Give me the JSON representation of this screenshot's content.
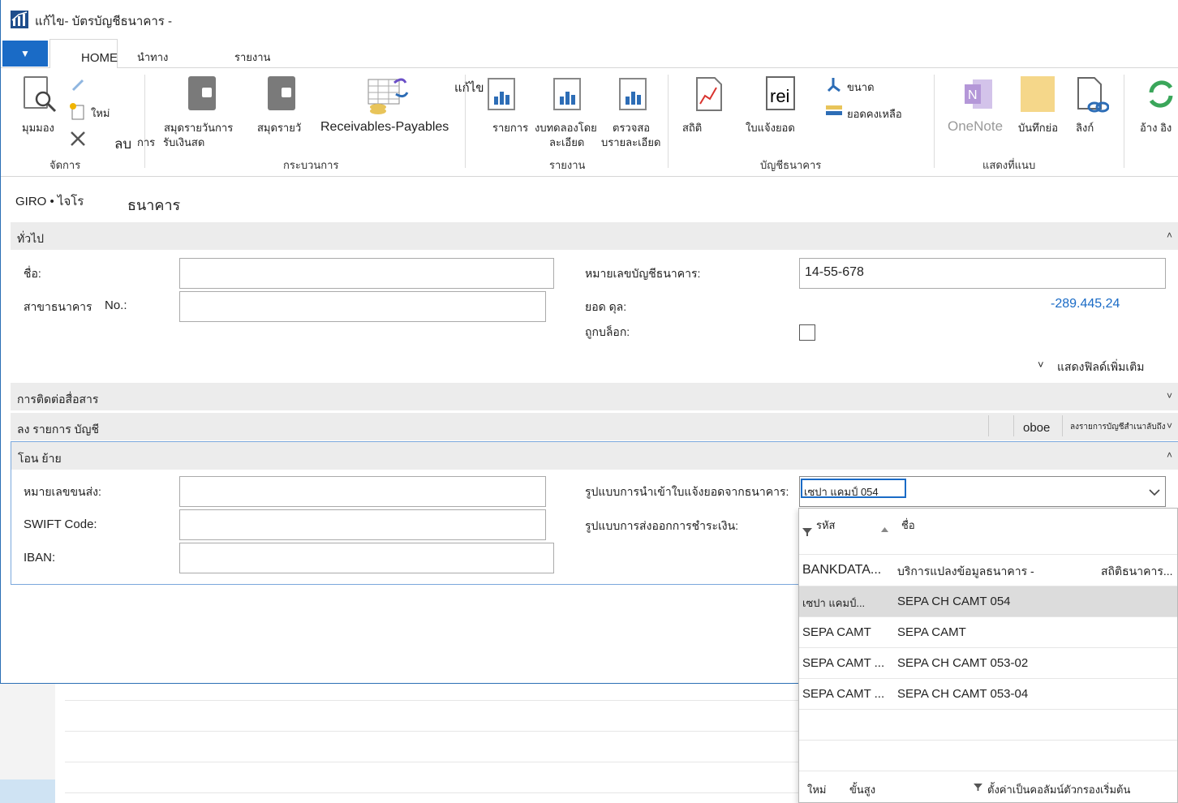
{
  "window": {
    "title": "แก้ไข- บัตรบัญชีธนาคาร -"
  },
  "tabs": {
    "app_menu": "▼",
    "home": "HOME",
    "navigate": "นำทาง",
    "reports": "รายงาน"
  },
  "ribbon": {
    "manage": {
      "view": "มุมมอง",
      "new": "ใหม่",
      "delete": "ลบ",
      "group": "จัดการ"
    },
    "process": {
      "cash_receipt_journals": "สมุดรายวันการ",
      "cash_receipt_journals_2": "รับเงินสด",
      "journal_short": "สมุดรายวั",
      "receivables_payables": "Receivables-Payables",
      "edit_float": "แก้ไข",
      "group": "กระบวนการ"
    },
    "reports": {
      "list": "รายการ",
      "detail_trial_balance": "งบทดลองโดย",
      "detail_trial_balance_2": "ละเอียด",
      "check_details": "ตรวจสอ",
      "check_details_2": "บรายละเอียด",
      "group": "รายงาน"
    },
    "bank_account": {
      "statistics": "สถิติ",
      "statements": "ใบแจ้งยอด",
      "statement_icon_text": "rei",
      "size": "ขนาด",
      "balance": "ยอดคงเหลือ",
      "group": "บัญชีธนาคาร"
    },
    "show_attached": {
      "onenote": "OneNote",
      "notes": "บันทึกย่อ",
      "links": "ลิงก์",
      "group": "แสดงที่แนบ"
    },
    "refresh": {
      "label": "อ้าง อิง"
    }
  },
  "page": {
    "header_code": "GIRO • ไจโร",
    "header_name": "ธนาคาร"
  },
  "general": {
    "title": "ทั่วไป",
    "chevron": "˄",
    "name_label": "ชื่อ:",
    "name_value": "",
    "branch_label": "สาขาธนาคาร",
    "branch_no_label": "No.:",
    "branch_value": "",
    "account_no_label": "หมายเลขบัญชีธนาคาร:",
    "account_no_value": "14-55-678",
    "balance_label": "ยอด ดุล:",
    "balance_value": "-289.445,24",
    "blocked_label": "ถูกบล็อก:",
    "show_more": "แสดงฟิลด์เพิ่มเติม",
    "show_more_icon": "˅"
  },
  "communication": {
    "title": "การติดต่อสื่อสาร",
    "chevron": "˅"
  },
  "posting": {
    "title": "ลง รายการ บัญชี",
    "value_short": "oboe",
    "value_long": "ลงรายการบัญชีสำเนาลับถึง",
    "chevron": "˅"
  },
  "transfer": {
    "title": "โอน ย้าย",
    "chevron": "˄",
    "transit_label": "หมายเลขขนส่ง:",
    "swift_label": "SWIFT Code:",
    "iban_label": "IBAN:",
    "import_format_label": "รูปแบบการนำเข้าใบแจ้งยอดจากธนาคาร:",
    "import_format_value": "เซปา แคมป์ 054",
    "export_format_label": "รูปแบบการส่งออกการชำระเงิน:"
  },
  "dropdown": {
    "col_code": "รหัส",
    "col_name": "ชื่อ",
    "rows": [
      {
        "code": "BANKDATA...",
        "name": "บริการแปลงข้อมูลธนาคาร -",
        "extra": "สถิติธนาคาร..."
      },
      {
        "code": "เซปา แคมป์...",
        "name": "SEPA CH CAMT 054",
        "extra": ""
      },
      {
        "code": "SEPA CAMT",
        "name": "SEPA CAMT",
        "extra": ""
      },
      {
        "code": "SEPA CAMT ...",
        "name": "SEPA CH CAMT 053-02",
        "extra": ""
      },
      {
        "code": "SEPA CAMT ...",
        "name": "SEPA CH CAMT 053-04",
        "extra": ""
      }
    ],
    "footer_new": "ใหม่",
    "footer_advanced": "ขั้นสูง",
    "footer_filter": "ตั้งค่าเป็นคอลัมน์ตัวกรองเริ่มต้น"
  },
  "colors": {
    "accent": "#1a6bc6",
    "value_blue": "#1a6bc6",
    "fasttab_bg": "#ececec"
  }
}
